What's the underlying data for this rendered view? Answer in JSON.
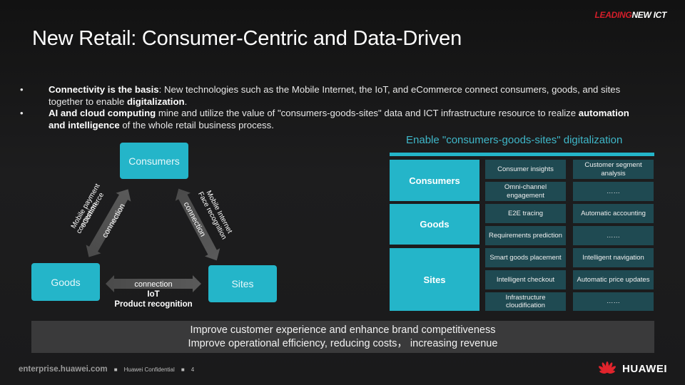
{
  "header": {
    "logo_left": "LEADING",
    "logo_right": "NEW ICT",
    "title": "New Retail: Consumer-Centric and Data-Driven"
  },
  "bullets": [
    {
      "marker": "•",
      "bold_lead": "Connectivity is the basis",
      "text_1": ": New technologies such as the Mobile Internet, the IoT, and eCommerce connect consumers, goods, and sites together to enable ",
      "bold_mid": "digitalization",
      "text_2": "."
    },
    {
      "marker": "•",
      "bold_lead": "AI and cloud computing",
      "text_1": " mine and utilize the value of \"consumers-goods-sites\" data and ICT infrastructure resource to realize ",
      "bold_mid": "automation and intelligence",
      "text_2": " of the whole retail business process."
    }
  ],
  "diagram": {
    "nodes": {
      "consumers": "Consumers",
      "goods": "Goods",
      "sites": "Sites"
    },
    "left_arrow": {
      "label": "connection",
      "tech_line1": "Mobile payment",
      "tech_line2": "eCommerce"
    },
    "right_arrow": {
      "label": "connection",
      "tech_line1": "Mobile Internet",
      "tech_line2": "Face recognition"
    },
    "bottom_arrow": {
      "label": "connection",
      "tech_line1": "IoT",
      "tech_line2": "Product recognition"
    }
  },
  "panel": {
    "heading": "Enable \"consumers-goods-sites\" digitalization",
    "categories": [
      {
        "name": "Consumers",
        "rows": [
          [
            "Consumer insights",
            "Customer segment analysis"
          ],
          [
            "Omni-channel engagement",
            "……"
          ]
        ]
      },
      {
        "name": "Goods",
        "rows": [
          [
            "E2E tracing",
            "Automatic accounting"
          ],
          [
            "Requirements prediction",
            "……"
          ]
        ]
      },
      {
        "name": "Sites",
        "rows": [
          [
            "Smart goods placement",
            "Intelligent navigation"
          ],
          [
            "Intelligent checkout",
            "Automatic price updates"
          ],
          [
            "Infrastructure cloudification",
            "……"
          ]
        ]
      }
    ]
  },
  "summary": {
    "line1": "Improve customer experience and enhance brand competitiveness",
    "line2": "Improve operational efficiency, reducing costs， increasing revenue"
  },
  "footer": {
    "site": "enterprise.huawei.com",
    "separator": "■",
    "confidential": "Huawei Confidential",
    "page": "4",
    "brand": "HUAWEI"
  },
  "colors": {
    "accent_teal": "#24b5c9",
    "cell_dark_teal": "#1f4a52",
    "brand_red": "#d41e2a",
    "arrow_gray": "#505050"
  }
}
